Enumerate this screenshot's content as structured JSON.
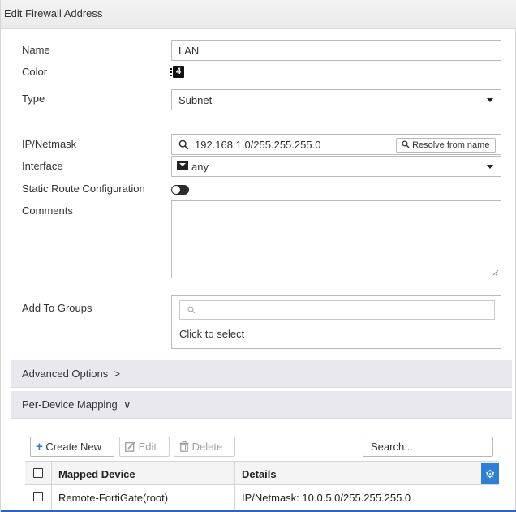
{
  "dialog": {
    "title": "Edit Firewall Address"
  },
  "form": {
    "name": {
      "label": "Name",
      "value": "LAN"
    },
    "color": {
      "label": "Color",
      "value": "4"
    },
    "type": {
      "label": "Type",
      "value": "Subnet"
    },
    "ip_netmask": {
      "label": "IP/Netmask",
      "value": "192.168.1.0/255.255.255.0",
      "resolve_label": "Resolve from name"
    },
    "interface": {
      "label": "Interface",
      "value": "any"
    },
    "static_route": {
      "label": "Static Route Configuration"
    },
    "comments": {
      "label": "Comments",
      "value": ""
    },
    "add_to_groups": {
      "label": "Add To Groups",
      "placeholder": "Click to select"
    }
  },
  "sections": {
    "advanced": {
      "label": "Advanced Options",
      "chevron": ">"
    },
    "per_device": {
      "label": "Per-Device Mapping",
      "chevron": "∨"
    }
  },
  "toolbar": {
    "create_new": "Create New",
    "edit": "Edit",
    "delete": "Delete",
    "search_placeholder": "Search..."
  },
  "table": {
    "columns": [
      "Mapped Device",
      "Details"
    ],
    "rows": [
      {
        "device": "Remote-FortiGate(root)",
        "details": "IP/Netmask: 10.0.5.0/255.255.255.0"
      }
    ]
  },
  "icons": {
    "accent": "#2f7fd6"
  }
}
